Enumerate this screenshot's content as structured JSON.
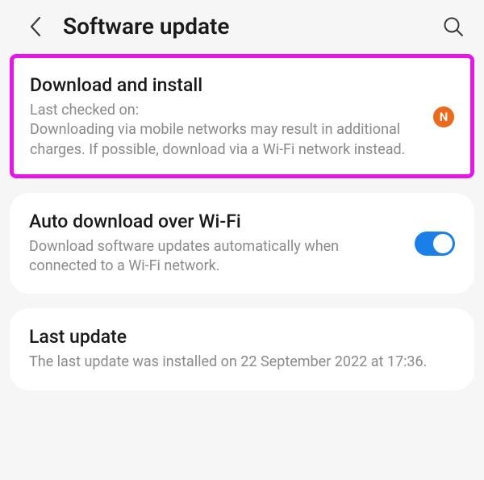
{
  "header": {
    "title": "Software update"
  },
  "items": {
    "download_install": {
      "title": "Download and install",
      "desc_line1": "Last checked on:",
      "desc_line2": "Downloading via mobile networks may result in additional charges. If possible, download via a Wi-Fi network instead.",
      "badge_text": "N"
    },
    "auto_download": {
      "title": "Auto download over Wi-Fi",
      "desc": "Download software updates automatically when connected to a Wi-Fi network.",
      "toggle_on": true
    },
    "last_update": {
      "title": "Last update",
      "desc": "The last update was installed on 22 September 2022 at 17:36."
    }
  },
  "colors": {
    "highlight_border": "#e815e8",
    "badge_bg": "#ea6b1e",
    "toggle_on": "#1a7fe8"
  }
}
